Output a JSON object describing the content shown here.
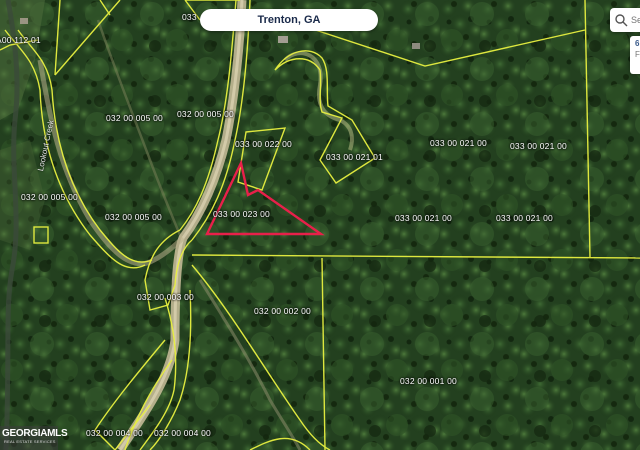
{
  "header": {
    "title": "Trenton, GA"
  },
  "search": {
    "placeholder": "Sea"
  },
  "info_card": {
    "line1": "6",
    "line2": "F"
  },
  "colors": {
    "parcel_line": "#e8f040",
    "highlight": "#e8204a",
    "road": "#d9c9a3"
  },
  "road_label": "Lookout Creek",
  "parcels": [
    {
      "id": "033 00 000",
      "text": "033"
    },
    {
      "id": "a00-112-01",
      "text": "A00 112 01"
    },
    {
      "id": "032-00-005-00-a",
      "text": "032 00 005 00"
    },
    {
      "id": "032-00-005-00-b",
      "text": "032 00 005 00"
    },
    {
      "id": "032-00-005-00-c",
      "text": "032 00 005 00"
    },
    {
      "id": "032-00-005-00-d",
      "text": "032 00 005 00"
    },
    {
      "id": "033-00-022-00",
      "text": "033 00 022 00"
    },
    {
      "id": "033-00-021-01",
      "text": "033 00 021 01"
    },
    {
      "id": "033-00-021-00-a",
      "text": "033 00 021 00"
    },
    {
      "id": "033-00-021-00-b",
      "text": "033 00 021 00"
    },
    {
      "id": "033-00-021-00-c",
      "text": "033 00 021 00"
    },
    {
      "id": "033-00-021-00-d",
      "text": "033 00 021 00"
    },
    {
      "id": "033-00-023-00",
      "text": "033 00 023 00"
    },
    {
      "id": "032-00-003-00",
      "text": "032 00 003 00"
    },
    {
      "id": "032-00-002-00",
      "text": "032 00 002 00"
    },
    {
      "id": "032-00-001-00",
      "text": "032 00 001 00"
    },
    {
      "id": "032-00-004-00-a",
      "text": "032 00 004 00"
    },
    {
      "id": "032-00-004-00-b",
      "text": "032 00 004 00"
    }
  ],
  "watermark": {
    "main": "GEORGIAMLS",
    "sub": "REAL ESTATE SERVICES"
  }
}
